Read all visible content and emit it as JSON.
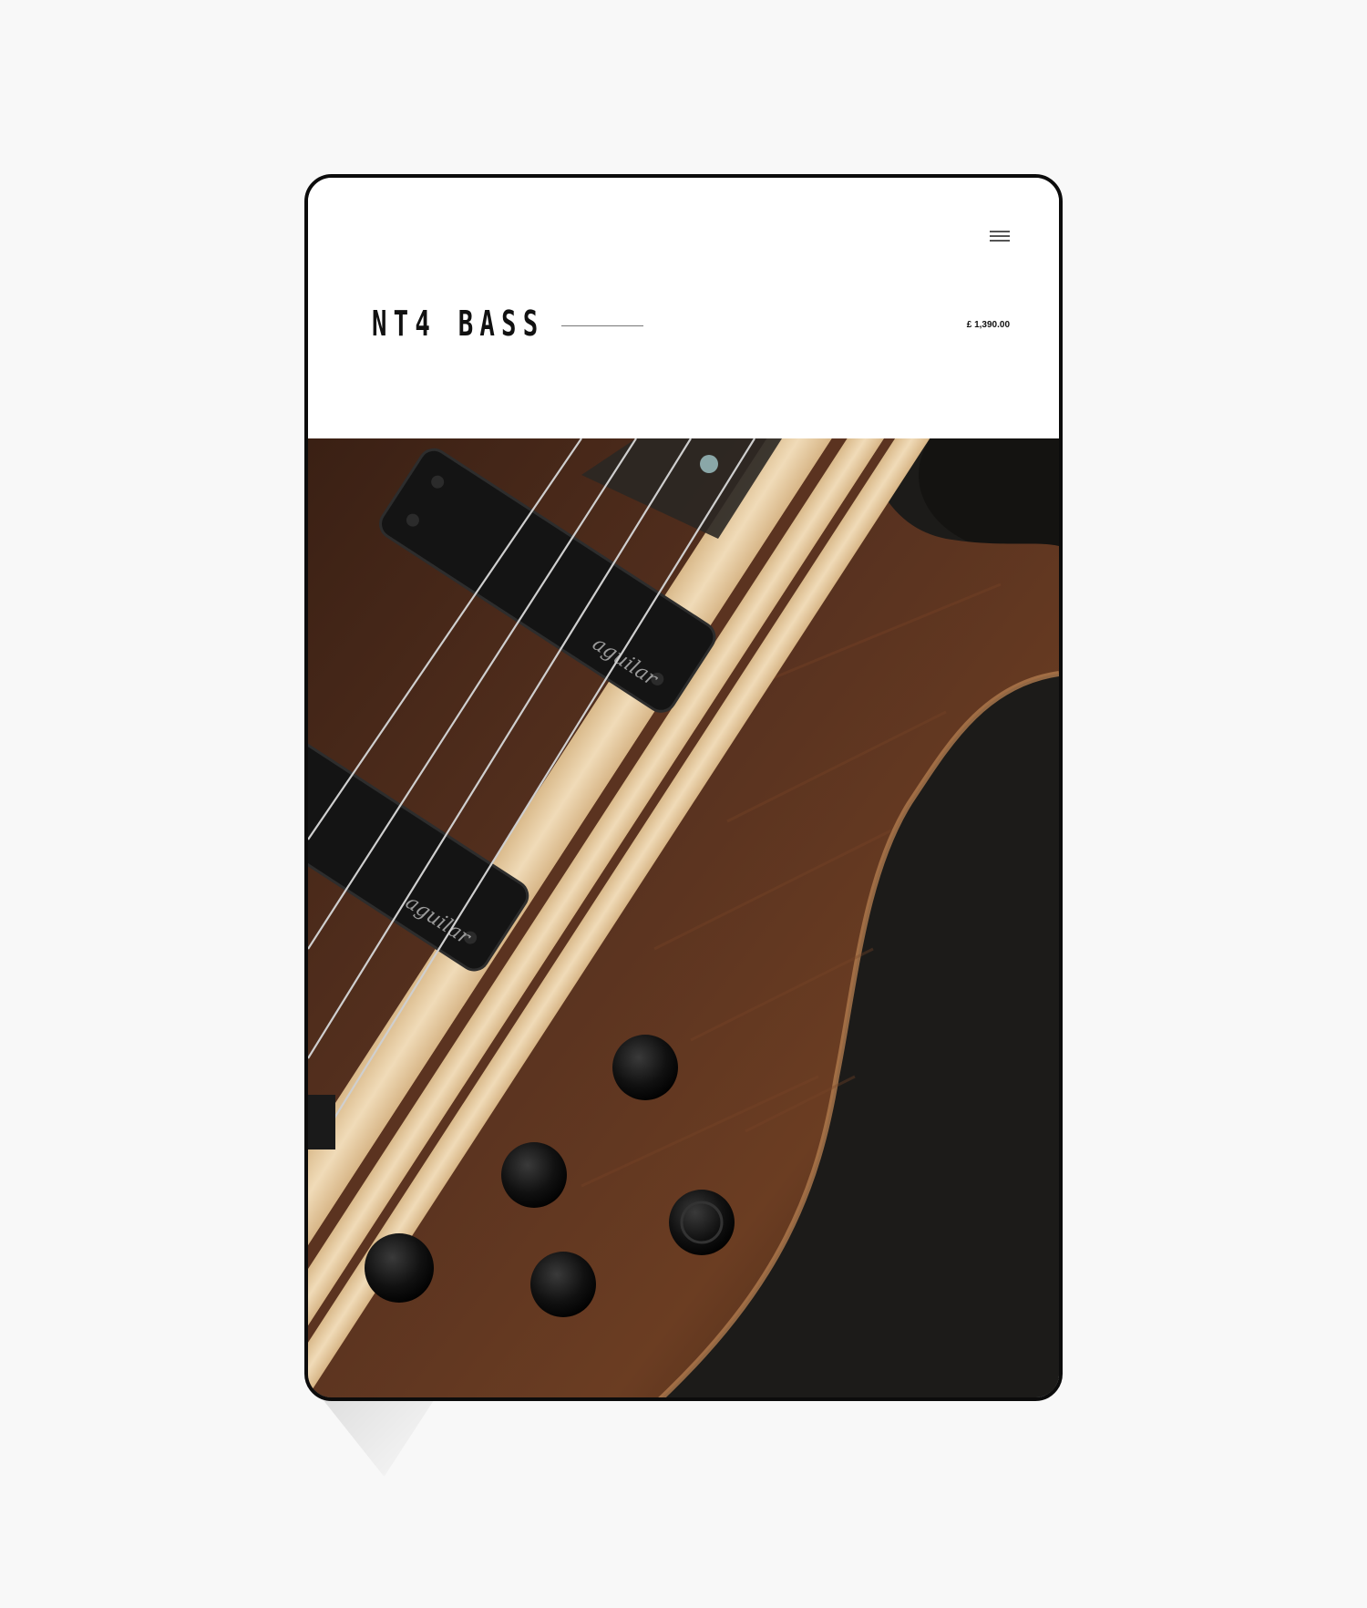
{
  "product": {
    "title": "NT4 BASS",
    "price": "£ 1,390.00"
  },
  "nav": {
    "menu_icon": "hamburger-menu-icon"
  },
  "hero": {
    "pickup_brand": "aguilar",
    "alt_subject": "bass guitar body close-up"
  },
  "colors": {
    "background": "#f8f8f8",
    "frame": "#0c0c0c",
    "wood": "#4a2a1a",
    "maple": "#e8cfa6",
    "dark": "#1c1b19"
  }
}
